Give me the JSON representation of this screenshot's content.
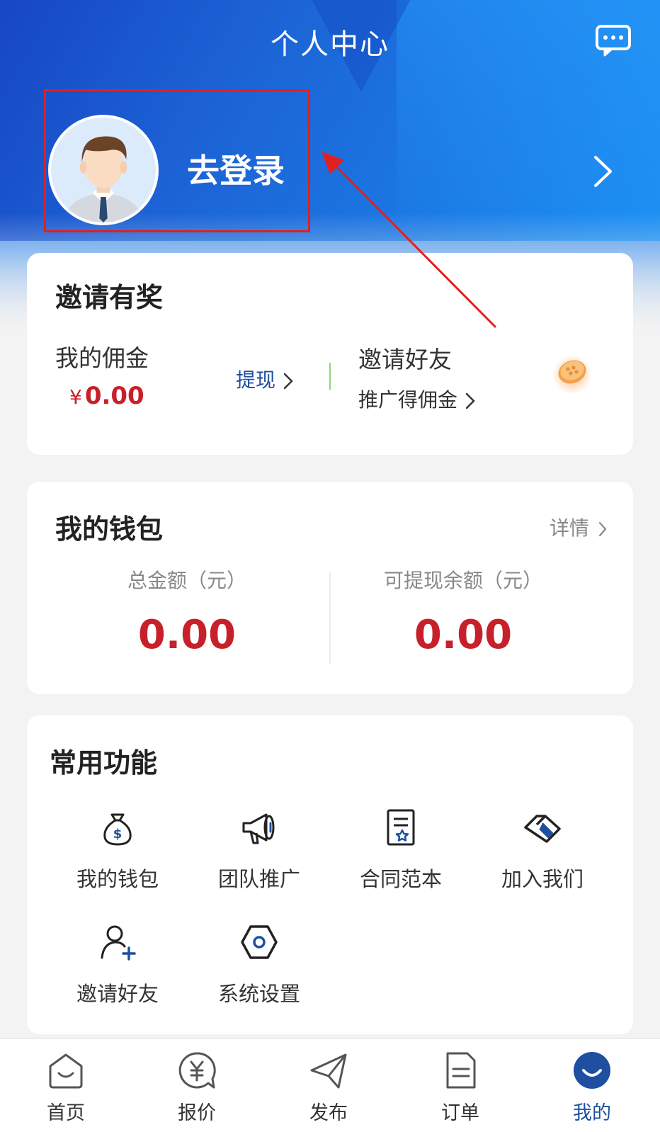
{
  "header": {
    "title": "个人中心",
    "login_text": "去登录"
  },
  "invite": {
    "title": "邀请有奖",
    "commission_label": "我的佣金",
    "commission_currency": "¥",
    "commission_value": "0.00",
    "withdraw_label": "提现",
    "invite_friends_label": "邀请好友",
    "promo_label": "推广得佣金"
  },
  "wallet": {
    "title": "我的钱包",
    "details_label": "详情",
    "total_label": "总金额（元）",
    "total_value": "0.00",
    "withdrawable_label": "可提现余额（元）",
    "withdrawable_value": "0.00"
  },
  "functions": {
    "title": "常用功能",
    "items": [
      {
        "label": "我的钱包",
        "icon": "money-bag-icon"
      },
      {
        "label": "团队推广",
        "icon": "megaphone-icon"
      },
      {
        "label": "合同范本",
        "icon": "contract-icon"
      },
      {
        "label": "加入我们",
        "icon": "handshake-icon"
      },
      {
        "label": "邀请好友",
        "icon": "add-user-icon"
      },
      {
        "label": "系统设置",
        "icon": "settings-hex-icon"
      }
    ]
  },
  "nav": {
    "items": [
      {
        "label": "首页",
        "icon": "home-icon"
      },
      {
        "label": "报价",
        "icon": "quote-icon"
      },
      {
        "label": "发布",
        "icon": "send-icon"
      },
      {
        "label": "订单",
        "icon": "order-icon"
      },
      {
        "label": "我的",
        "icon": "profile-icon",
        "active": true
      }
    ]
  },
  "colors": {
    "primary_blue": "#1e4fa0",
    "header_blue": "#1f6fd8",
    "amount_red": "#c8202a",
    "highlight_red": "#e02020"
  }
}
